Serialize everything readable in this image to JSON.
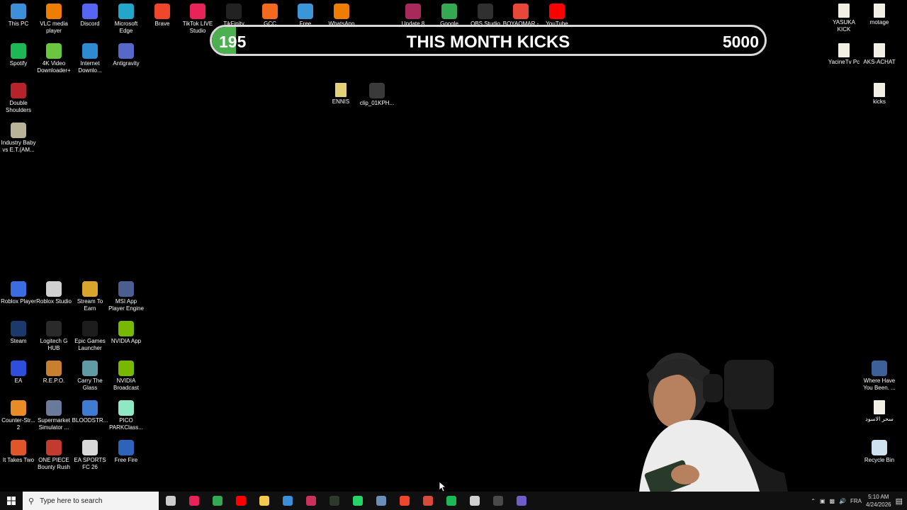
{
  "desktop": {
    "icons_left": [
      {
        "label": "This PC",
        "icon": "pc-icon",
        "color": "#3c8fd8"
      },
      {
        "label": "VLC media player",
        "icon": "vlc-icon",
        "color": "#ef7d00"
      },
      {
        "label": "Discord",
        "icon": "discord-icon",
        "color": "#5865f2"
      },
      {
        "label": "Microsoft Edge",
        "icon": "edge-icon",
        "color": "#22a7c8"
      },
      {
        "label": "Brave",
        "icon": "brave-icon",
        "color": "#f0462a"
      },
      {
        "label": "TikTok LIVE Studio",
        "icon": "tiktok-icon",
        "color": "#e9225a"
      },
      {
        "label": "TikFinity",
        "icon": "tikfinity-icon",
        "color": "#222222"
      },
      {
        "label": "GCC",
        "icon": "gcc-icon",
        "color": "#f36a1f"
      },
      {
        "label": "Free Downlo...",
        "icon": "download-icon",
        "color": "#3b95d6"
      },
      {
        "label": "WhatsApp Video 2026-...",
        "icon": "vlc-icon",
        "color": "#ef7d00"
      },
      {
        "label": "Update 8",
        "icon": "winrar-icon",
        "color": "#a8295c"
      },
      {
        "label": "Google Chrome",
        "icon": "chrome-icon",
        "color": "#35a853"
      },
      {
        "label": "OBS Studio",
        "icon": "obs-icon",
        "color": "#303030"
      },
      {
        "label": "BOYAOMAR - Chrome",
        "icon": "chrome-icon",
        "color": "#e9473a"
      },
      {
        "label": "YouTube",
        "icon": "youtube-icon",
        "color": "#ff0000"
      },
      {
        "label": "Spotify",
        "icon": "spotify-icon",
        "color": "#1db954"
      },
      {
        "label": "4K Video Downloader+",
        "icon": "4k-icon",
        "color": "#6ac53f"
      },
      {
        "label": "Internet Downlo...",
        "icon": "idm-icon",
        "color": "#2f8bd1"
      },
      {
        "label": "Antigravity",
        "icon": "antigravity-icon",
        "color": "#5668c8"
      },
      {
        "label": "Double Shoulders",
        "icon": "ds-icon",
        "color": "#b7232b"
      },
      {
        "label": "Industry Baby vs E.T.(AM...",
        "icon": "video-icon",
        "color": "#b9b39a"
      },
      {
        "label": "Roblox Player",
        "icon": "roblox-icon",
        "color": "#3c6de0"
      },
      {
        "label": "Roblox Studio",
        "icon": "roblox-studio-icon",
        "color": "#d0d0d0"
      },
      {
        "label": "Stream To Earn",
        "icon": "stream-icon",
        "color": "#d9a52c"
      },
      {
        "label": "MSI App Player Engine",
        "icon": "msi-icon",
        "color": "#4a5e8f"
      },
      {
        "label": "Steam",
        "icon": "steam-icon",
        "color": "#1b3a6b"
      },
      {
        "label": "Logitech G HUB",
        "icon": "logitech-icon",
        "color": "#2a2a2a"
      },
      {
        "label": "Epic Games Launcher",
        "icon": "epic-icon",
        "color": "#1d1d1d"
      },
      {
        "label": "NVIDIA App",
        "icon": "nvidia-icon",
        "color": "#76b900"
      },
      {
        "label": "EA",
        "icon": "ea-icon",
        "color": "#2e4fdc"
      },
      {
        "label": "R.E.P.O.",
        "icon": "repo-icon",
        "color": "#c7802e"
      },
      {
        "label": "Carry The Glass",
        "icon": "glass-icon",
        "color": "#5f9aa6"
      },
      {
        "label": "NVIDIA Broadcast",
        "icon": "nvidia-icon",
        "color": "#76b900"
      },
      {
        "label": "Counter-Str... 2",
        "icon": "cs2-icon",
        "color": "#e98b26"
      },
      {
        "label": "Supermarket Simulator ...",
        "icon": "supermarket-icon",
        "color": "#6a7a9a"
      },
      {
        "label": "BLOODSTR...",
        "icon": "bloodstrike-icon",
        "color": "#3f7bd0"
      },
      {
        "label": "PICO PARKClass...",
        "icon": "pico-icon",
        "color": "#8fe8c3"
      },
      {
        "label": "It Takes Two",
        "icon": "ittakestwo-icon",
        "color": "#e0562a"
      },
      {
        "label": "ONE PIECE Bounty Rush",
        "icon": "onepiece-icon",
        "color": "#c33a2f"
      },
      {
        "label": "EA SPORTS FC 26",
        "icon": "fc-icon",
        "color": "#d9d9d9"
      },
      {
        "label": "Free Fire",
        "icon": "freefire-icon",
        "color": "#2d63b8"
      }
    ],
    "icons_middle": [
      {
        "label": "ENNIS",
        "icon": "file-icon",
        "color": "#e3d27a"
      },
      {
        "label": "clip_01KPH...",
        "icon": "video-icon",
        "color": "#3a3a3a"
      }
    ],
    "icons_right": [
      {
        "label": "YASUKA KICK",
        "icon": "file-icon",
        "color": "#f2efe4"
      },
      {
        "label": "motage",
        "icon": "file-icon",
        "color": "#f2efe4"
      },
      {
        "label": "YacineTv Pc",
        "icon": "file-icon",
        "color": "#f2efe4"
      },
      {
        "label": "AKS-ACHAT",
        "icon": "file-icon",
        "color": "#f2efe4"
      },
      {
        "label": "kicks",
        "icon": "file-icon",
        "color": "#f2efe4"
      },
      {
        "label": "Where Have You Been. ...",
        "icon": "video-icon",
        "color": "#3d5f9a"
      },
      {
        "label": "سحر الاسود",
        "icon": "file-icon",
        "color": "#f2efe4"
      },
      {
        "label": "Recycle Bin",
        "icon": "recycle-bin-icon",
        "color": "#cfe0ef"
      }
    ]
  },
  "overlay": {
    "current": "195",
    "title": "THIS MONTH KICKS",
    "goal": "5000",
    "progress_fraction": 0.039,
    "accent": "#4caf50"
  },
  "taskbar": {
    "search_placeholder": "Type here to search",
    "apps": [
      {
        "name": "task-view-icon",
        "color": "#cccccc"
      },
      {
        "name": "tiktok-icon",
        "color": "#e9225a"
      },
      {
        "name": "chrome-icon",
        "color": "#35a853"
      },
      {
        "name": "youtube-icon",
        "color": "#ff0000"
      },
      {
        "name": "folder-icon",
        "color": "#f2c94c"
      },
      {
        "name": "store-icon",
        "color": "#3b8fd8"
      },
      {
        "name": "tikfinity-icon",
        "color": "#c8325b"
      },
      {
        "name": "terminal-icon",
        "color": "#2c3a2c"
      },
      {
        "name": "whatsapp-icon",
        "color": "#25d366"
      },
      {
        "name": "network-icon",
        "color": "#6b8fb8"
      },
      {
        "name": "brave-icon",
        "color": "#f0462a"
      },
      {
        "name": "chrome-icon",
        "color": "#d84a3a"
      },
      {
        "name": "spotify-icon",
        "color": "#1db954"
      },
      {
        "name": "capcut-icon",
        "color": "#d0d0d0"
      },
      {
        "name": "obs-icon",
        "color": "#4a4a4a"
      },
      {
        "name": "chrome-profile-icon",
        "color": "#6d5fc7"
      }
    ],
    "language": "FRA",
    "time": "5:10 AM",
    "date": "4/24/2026"
  }
}
